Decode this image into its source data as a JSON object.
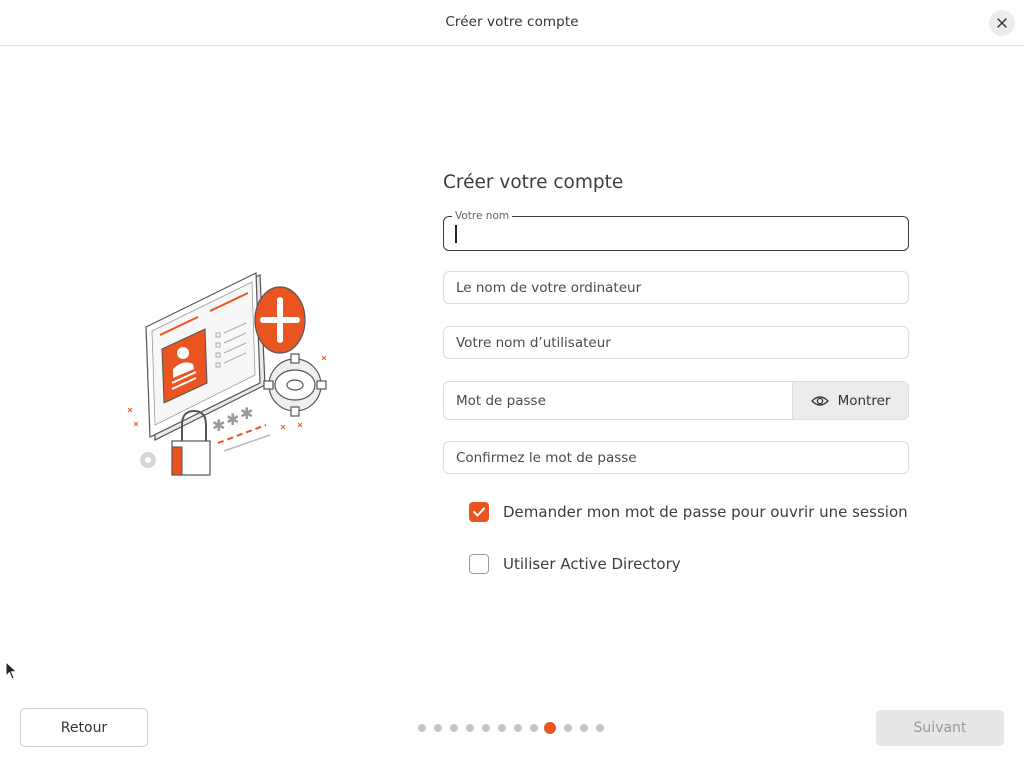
{
  "window": {
    "title": "Créer votre compte"
  },
  "illustration": {
    "icon": "account-security-illustration"
  },
  "form": {
    "heading": "Créer votre compte",
    "name_field": {
      "floating_label": "Votre nom",
      "value": ""
    },
    "computer_field": {
      "placeholder": "Le nom de votre ordinateur"
    },
    "username_field": {
      "placeholder": "Votre nom d’utilisateur"
    },
    "password_field": {
      "placeholder": "Mot de passe",
      "show_label": "Montrer"
    },
    "confirm_field": {
      "placeholder": "Confirmez le mot de passe"
    },
    "require_password": {
      "label": "Demander mon mot de passe pour ouvrir une session",
      "checked": true
    },
    "active_directory": {
      "label": "Utiliser Active Directory",
      "checked": false
    }
  },
  "footer": {
    "back_label": "Retour",
    "next_label": "Suivant",
    "next_enabled": false,
    "progress": {
      "total_steps": 12,
      "current_step": 9
    }
  },
  "colors": {
    "accent": "#e95420",
    "disabled_bg": "#e6e6e6",
    "dot_inactive": "#c4c4c4"
  }
}
